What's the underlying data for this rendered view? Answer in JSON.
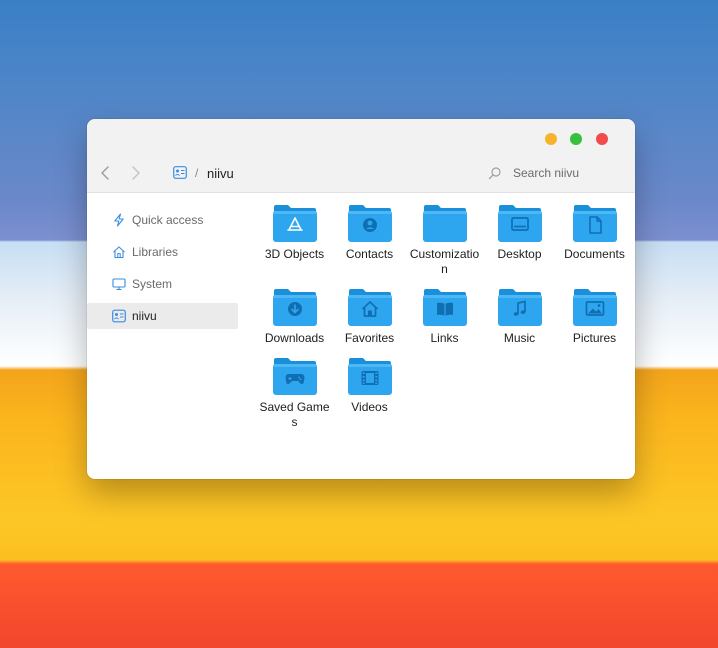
{
  "window": {
    "title": "niivu",
    "traffic_lights": {
      "minimize_color": "#f7b42b",
      "maximize_color": "#37c03d",
      "close_color": "#f24b4b"
    }
  },
  "breadcrumb": {
    "separator": "/",
    "current": "niivu",
    "icon": "user-card-icon"
  },
  "search": {
    "placeholder": "Search niivu",
    "value": ""
  },
  "sidebar": {
    "items": [
      {
        "label": "Quick access",
        "icon": "lightning-icon",
        "active": false
      },
      {
        "label": "Libraries",
        "icon": "home-icon",
        "active": false
      },
      {
        "label": "System",
        "icon": "monitor-icon",
        "active": false
      },
      {
        "label": "niivu",
        "icon": "user-card-icon",
        "active": true
      }
    ]
  },
  "folders": [
    {
      "label": "3D Objects",
      "icon": "app-store-icon"
    },
    {
      "label": "Contacts",
      "icon": "contact-icon"
    },
    {
      "label": "Customization",
      "icon": "folder-icon"
    },
    {
      "label": "Desktop",
      "icon": "desktop-icon"
    },
    {
      "label": "Documents",
      "icon": "document-icon"
    },
    {
      "label": "Downloads",
      "icon": "download-icon"
    },
    {
      "label": "Favorites",
      "icon": "home-icon"
    },
    {
      "label": "Links",
      "icon": "book-icon"
    },
    {
      "label": "Music",
      "icon": "music-note-icon"
    },
    {
      "label": "Pictures",
      "icon": "picture-icon"
    },
    {
      "label": "Saved Games",
      "icon": "gamepad-icon"
    },
    {
      "label": "Videos",
      "icon": "film-icon"
    }
  ],
  "colors": {
    "folder_front": "#2ea6ef",
    "folder_back": "#1a8fdb",
    "folder_glyph": "#106fb3",
    "accent": "#3a8ee0"
  }
}
